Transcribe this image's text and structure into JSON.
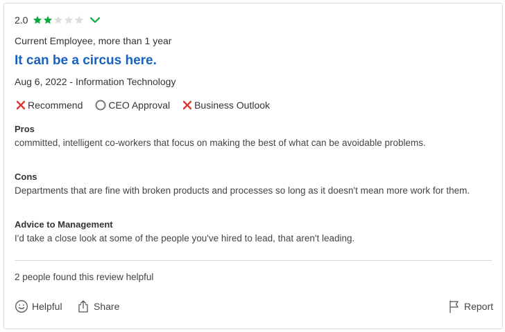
{
  "review": {
    "rating": "2.0",
    "rating_value": 2,
    "rating_max": 5,
    "employee_status": "Current Employee, more than 1 year",
    "title": "It can be a circus here.",
    "meta": "Aug 6, 2022 - Information Technology",
    "indicators": [
      {
        "label": "Recommend",
        "icon": "x-icon"
      },
      {
        "label": "CEO Approval",
        "icon": "circle-icon"
      },
      {
        "label": "Business Outlook",
        "icon": "x-icon"
      }
    ],
    "pros_label": "Pros",
    "pros_text": "committed, intelligent co-workers that focus on making the best of what can be avoidable problems.",
    "cons_label": "Cons",
    "cons_text": "Departments that are fine with broken products and processes so long as it doesn't mean more work for them.",
    "advice_label": "Advice to Management",
    "advice_text": "I'd take a close look at some of the people you've hired to lead, that aren't leading.",
    "helpful_count_text": "2 people found this review helpful"
  },
  "actions": {
    "helpful_label": "Helpful",
    "share_label": "Share",
    "report_label": "Report"
  },
  "colors": {
    "star_filled": "#0caa41",
    "star_empty": "#dedede",
    "title": "#1861bf",
    "x_mark": "#e0372c",
    "chevron": "#0caa41"
  }
}
